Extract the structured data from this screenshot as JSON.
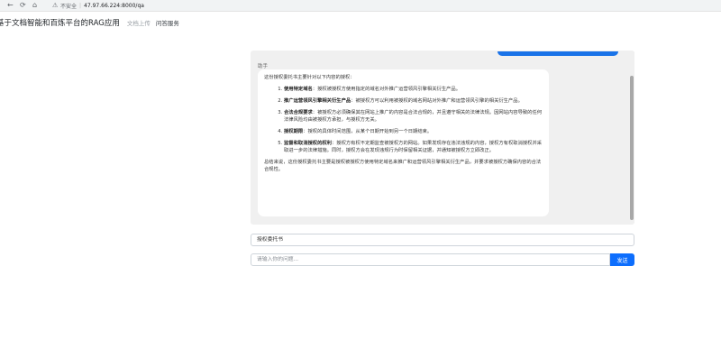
{
  "browser": {
    "back_icon": "←",
    "refresh_icon": "⟳",
    "home_icon": "⌂",
    "warning_icon": "⚠",
    "security_label": "不安全",
    "url": "47.97.66.224:8000/qa"
  },
  "nav": {
    "brand": "基于文档智能和百炼平台的RAG应用",
    "links": [
      {
        "label": "文档上传"
      },
      {
        "label": "问答服务"
      }
    ]
  },
  "chat": {
    "sender": "助手",
    "intro": "这份授权委托书主要针对以下内容的授权：",
    "items": [
      {
        "title": "使用特定域名",
        "text": "：授权被授权方使用指定的域名对外推广运营领风引擎相关衍生产品。"
      },
      {
        "title": "推广运营领风引擎相关衍生产品",
        "text": "：被授权方可以利用被授权的域名网站对外推广和运营领风引擎的相关衍生产品。"
      },
      {
        "title": "合法合规要求",
        "text": "：被授权方必须确保其在网站上推广的内容是合法合规的，并且遵守相关的法律法规。因网站内容导致的任何法律风险均由被授权方承担，与授权方无关。"
      },
      {
        "title": "授权期限",
        "text": "：授权的具体时间范围，从某个日期开始到另一个日期结束。"
      },
      {
        "title": "监督和取消授权的权利",
        "text": "：授权方有权不定期监查被授权方的网站。如果发现存在违法违规的内容，授权方有权取消授权并采取进一步的法律措施。同时，授权方会在发现违规行为时保留相关证据，并通知被授权方立即改正。"
      }
    ],
    "summary": "总结来说，这份授权委托书主要是授权被授权方使用特定域名来推广和运营领风引擎相关衍生产品，并要求被授权方确保内容的合法合规性。"
  },
  "last_query": "授权委托书",
  "query_input": {
    "placeholder": "请输入你的问题..."
  },
  "send_button": "发送",
  "colors": {
    "accent": "#0d6efd",
    "chat_bg": "#f0f0f0",
    "user_bubble": "#1a73e8"
  }
}
